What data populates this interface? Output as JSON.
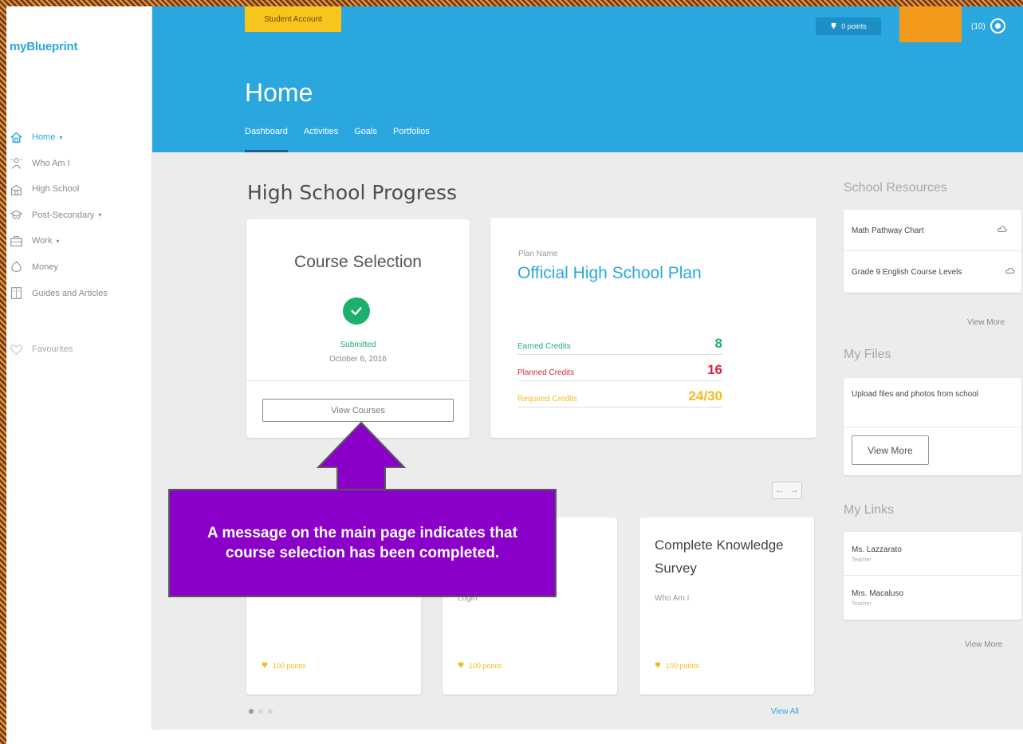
{
  "app": {
    "logo": "myBlueprint"
  },
  "sidebar": {
    "items": [
      {
        "label": "Home",
        "icon": "home-icon",
        "caret": "▾",
        "active": true
      },
      {
        "label": "Who Am I",
        "icon": "person-icon",
        "caret": "",
        "active": false
      },
      {
        "label": "High School",
        "icon": "school-icon",
        "caret": "",
        "active": false
      },
      {
        "label": "Post-Secondary",
        "icon": "graduation-cap-icon",
        "caret": "▾",
        "active": false
      },
      {
        "label": "Work",
        "icon": "briefcase-icon",
        "caret": "▾",
        "active": false
      },
      {
        "label": "Money",
        "icon": "money-bag-icon",
        "caret": "",
        "active": false
      },
      {
        "label": "Guides and Articles",
        "icon": "book-icon",
        "caret": "",
        "active": false
      }
    ],
    "favorites": "Favourites"
  },
  "header": {
    "account_button": "Student Account",
    "points": "0 points",
    "notification_count": "(10)",
    "title": "Home",
    "tabs": [
      {
        "label": "Dashboard",
        "active": true
      },
      {
        "label": "Activities",
        "active": false
      },
      {
        "label": "Goals",
        "active": false
      },
      {
        "label": "Portfolios",
        "active": false
      }
    ]
  },
  "progress": {
    "section_title": "High School Progress",
    "course_selection": {
      "title": "Course Selection",
      "status": "Submitted",
      "date": "October 6, 2016",
      "button": "View Courses"
    },
    "plan": {
      "label": "Plan Name",
      "name": "Official High School Plan",
      "credits": [
        {
          "label": "Earned Credits",
          "value": "8",
          "color": "#1db06b"
        },
        {
          "label": "Planned Credits",
          "value": "16",
          "color": "#d7263d"
        },
        {
          "label": "Required Credits",
          "value": "24/30",
          "color": "#f2bd1d"
        }
      ]
    }
  },
  "activities": {
    "nav_prev": "←",
    "nav_next": "→",
    "cards": [
      {
        "title": "",
        "subtitle": "",
        "points": "100 points"
      },
      {
        "title": "",
        "subtitle": "Login",
        "points": "100 points"
      },
      {
        "title": "Complete Knowledge Survey",
        "subtitle": "Who Am I",
        "points": "100 points"
      }
    ],
    "view_all": "View All"
  },
  "resources": {
    "title": "School Resources",
    "items": [
      "Math Pathway Chart",
      "Grade 9 English Course Levels"
    ],
    "view_more": "View More"
  },
  "files": {
    "title": "My Files",
    "text": "Upload files and photos from school",
    "button": "View More"
  },
  "links": {
    "title": "My Links",
    "items": [
      {
        "name": "Ms. Lazzarato",
        "role": "Teacher"
      },
      {
        "name": "Mrs. Macaluso",
        "role": "Teacher"
      }
    ],
    "view_more": "View More"
  },
  "annotation": {
    "text": "A message on the main page indicates that course selection has been completed."
  },
  "colors": {
    "brand_blue": "#2aa7df",
    "success_green": "#1db06b",
    "account_yellow": "#f8c51d",
    "callout_purple": "#8a00c9",
    "header_orange": "#f39a1c"
  }
}
